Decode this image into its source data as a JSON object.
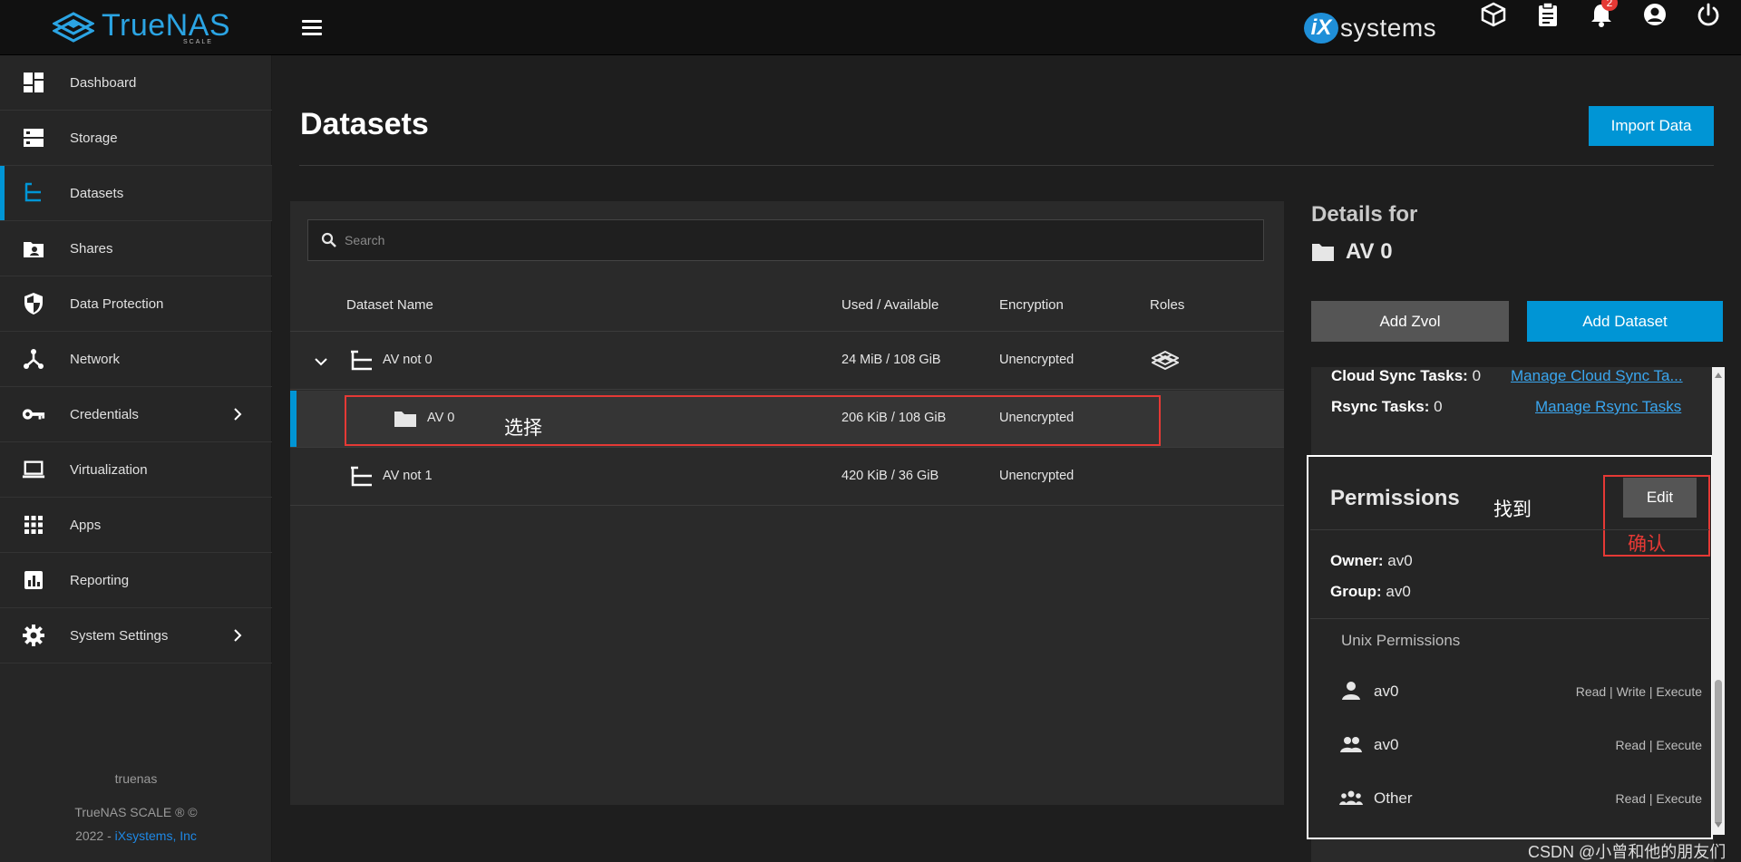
{
  "brand": {
    "logo_main": "TrueNAS",
    "logo_sub": "SCALE",
    "ix_letter": "iX",
    "ix_text": "systems"
  },
  "topbar": {
    "notification_count": "2",
    "icons": [
      "truecommand-icon",
      "clipboard-icon",
      "bell-icon",
      "account-icon",
      "power-icon"
    ]
  },
  "sidebar": {
    "items": [
      {
        "label": "Dashboard",
        "icon": "dashboard-icon"
      },
      {
        "label": "Storage",
        "icon": "storage-icon"
      },
      {
        "label": "Datasets",
        "icon": "datasets-icon",
        "active": true
      },
      {
        "label": "Shares",
        "icon": "shares-icon"
      },
      {
        "label": "Data Protection",
        "icon": "shield-icon"
      },
      {
        "label": "Network",
        "icon": "network-icon"
      },
      {
        "label": "Credentials",
        "icon": "key-icon",
        "has_submenu": true
      },
      {
        "label": "Virtualization",
        "icon": "laptop-icon"
      },
      {
        "label": "Apps",
        "icon": "apps-grid-icon"
      },
      {
        "label": "Reporting",
        "icon": "chart-icon"
      },
      {
        "label": "System Settings",
        "icon": "gear-icon",
        "has_submenu": true
      }
    ],
    "hostname": "truenas",
    "copyright_line1": "TrueNAS SCALE ® ©",
    "copyright_year": "2022 - ",
    "copyright_link": "iXsystems, Inc"
  },
  "page": {
    "title": "Datasets",
    "import_button": "Import Data"
  },
  "table": {
    "search_placeholder": "Search",
    "columns": [
      "Dataset Name",
      "Used / Available",
      "Encryption",
      "Roles"
    ],
    "rows": [
      {
        "name": "AV not 0",
        "used": "24 MiB / 108 GiB",
        "encryption": "Unencrypted",
        "role_icon": "truecommand-icon",
        "type": "pool",
        "expanded": true
      },
      {
        "name": "AV 0",
        "used": "206 KiB / 108 GiB",
        "encryption": "Unencrypted",
        "type": "folder",
        "selected": true
      },
      {
        "name": "AV not 1",
        "used": "420 KiB / 36 GiB",
        "encryption": "Unencrypted",
        "type": "pool"
      }
    ]
  },
  "annotations": {
    "select": "选择",
    "find": "找到",
    "confirm": "确认"
  },
  "details": {
    "heading": "Details for",
    "dataset_name": "AV 0",
    "add_zvol": "Add Zvol",
    "add_dataset": "Add Dataset",
    "cloud_sync_label": "Cloud Sync Tasks:",
    "cloud_sync_value": "0",
    "cloud_sync_link": "Manage Cloud Sync Ta...",
    "rsync_label": "Rsync Tasks:",
    "rsync_value": "0",
    "rsync_link": "Manage Rsync Tasks"
  },
  "permissions": {
    "title": "Permissions",
    "edit_button": "Edit",
    "owner_label": "Owner:",
    "owner_value": "av0",
    "group_label": "Group:",
    "group_value": "av0",
    "unix_title": "Unix Permissions",
    "entries": [
      {
        "name": "av0",
        "perm": "Read | Write | Execute",
        "icon": "user-icon"
      },
      {
        "name": "av0",
        "perm": "Read | Execute",
        "icon": "group-icon"
      },
      {
        "name": "Other",
        "perm": "Read | Execute",
        "icon": "others-icon"
      }
    ]
  },
  "watermark": "CSDN @小曾和他的朋友们",
  "colors": {
    "accent": "#0095d5",
    "annotation_red": "#e53935",
    "background": "#1e1e1e",
    "sidebar": "#262626",
    "topbar": "#111111"
  }
}
